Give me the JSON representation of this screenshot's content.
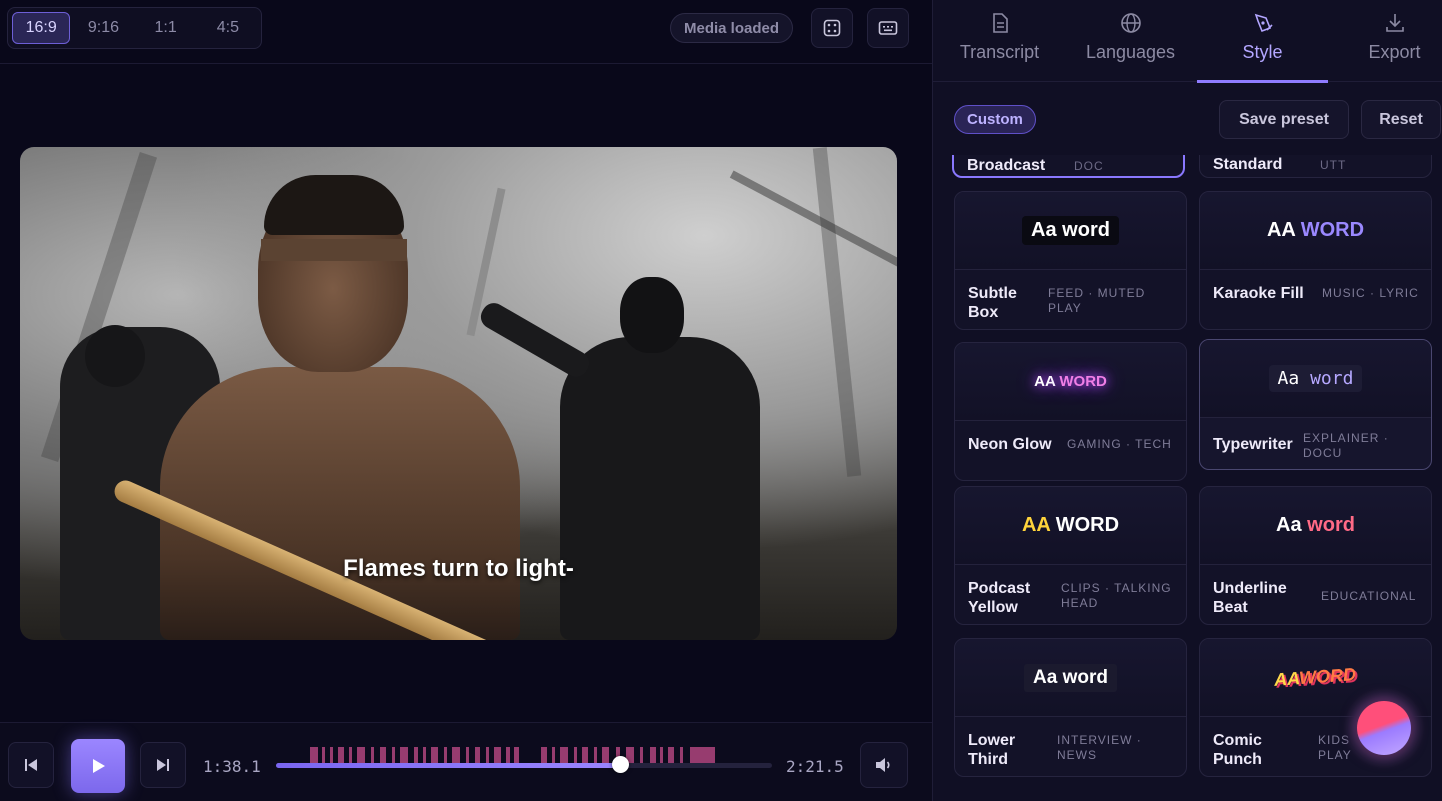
{
  "aspect_ratios": [
    {
      "label": "16:9",
      "active": true
    },
    {
      "label": "9:16",
      "active": false
    },
    {
      "label": "1:1",
      "active": false
    },
    {
      "label": "4:5",
      "active": false
    }
  ],
  "status": "Media loaded",
  "caption": "Flames turn to light-",
  "playback": {
    "current_time": "1:38.1",
    "duration": "2:21.5",
    "progress": 0.694
  },
  "tabs": [
    {
      "label": "Transcript",
      "icon": "document-icon",
      "active": false
    },
    {
      "label": "Languages",
      "icon": "globe-icon",
      "active": false
    },
    {
      "label": "Style",
      "icon": "pen-icon",
      "active": true
    },
    {
      "label": "Export",
      "icon": "download-icon",
      "active": false
    }
  ],
  "style_panel": {
    "custom_badge": "Custom",
    "save_preset": "Save preset",
    "reset": "Reset",
    "cut_off_presets": [
      {
        "name": "Broadcast",
        "tags": "DOC"
      },
      {
        "name": "Standard",
        "tags": "UTT"
      }
    ],
    "presets": [
      {
        "name": "Subtle Box",
        "tags": "FEED · MUTED PLAY",
        "preview_a": "Aa",
        "preview_b": "word"
      },
      {
        "name": "Karaoke Fill",
        "tags": "MUSIC · LYRIC",
        "preview_a": "AA",
        "preview_b": "WORD"
      },
      {
        "name": "Neon Glow",
        "tags": "GAMING · TECH",
        "preview_a": "AA",
        "preview_b": "WORD"
      },
      {
        "name": "Typewriter",
        "tags": "EXPLAINER · DOCU",
        "preview_a": "Aa",
        "preview_b": "word"
      },
      {
        "name": "Podcast Yellow",
        "tags": "CLIPS · TALKING HEAD",
        "preview_a": "AA",
        "preview_b": "WORD"
      },
      {
        "name": "Underline Beat",
        "tags": "EDUCATIONAL",
        "preview_a": "Aa",
        "preview_b": "word"
      },
      {
        "name": "Lower Third",
        "tags": "INTERVIEW · NEWS",
        "preview_a": "Aa",
        "preview_b": "word"
      },
      {
        "name": "Comic Punch",
        "tags": "KIDS · PLAY",
        "preview_a": "AA",
        "preview_b": "WORD"
      }
    ]
  },
  "colors": {
    "accent": "#8f7cff",
    "background": "#0b0a1a",
    "panel": "#100f24",
    "timeline_marker": "#b0457e"
  }
}
